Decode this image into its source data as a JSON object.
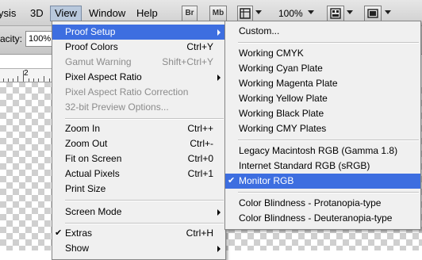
{
  "menubar": {
    "items": [
      "ysis",
      "3D",
      "View",
      "Window",
      "Help"
    ],
    "br_label": "Br",
    "mb_label": "Mb",
    "zoom": "100%"
  },
  "options": {
    "opacity_label": "acity:",
    "opacity_value": "100%"
  },
  "ruler": {
    "label": "2"
  },
  "view_menu": {
    "items": [
      {
        "label": "Proof Setup",
        "shortcut": "",
        "submenu": true,
        "highlighted": true,
        "disabled": false
      },
      {
        "label": "Proof Colors",
        "shortcut": "Ctrl+Y",
        "submenu": false,
        "disabled": false
      },
      {
        "label": "Gamut Warning",
        "shortcut": "Shift+Ctrl+Y",
        "submenu": false,
        "disabled": true
      },
      {
        "label": "Pixel Aspect Ratio",
        "shortcut": "",
        "submenu": true,
        "disabled": false
      },
      {
        "label": "Pixel Aspect Ratio Correction",
        "shortcut": "",
        "submenu": false,
        "disabled": true
      },
      {
        "label": "32-bit Preview Options...",
        "shortcut": "",
        "submenu": false,
        "disabled": true
      },
      {
        "label": "Zoom In",
        "shortcut": "Ctrl++",
        "submenu": false,
        "disabled": false
      },
      {
        "label": "Zoom Out",
        "shortcut": "Ctrl+-",
        "submenu": false,
        "disabled": false
      },
      {
        "label": "Fit on Screen",
        "shortcut": "Ctrl+0",
        "submenu": false,
        "disabled": false
      },
      {
        "label": "Actual Pixels",
        "shortcut": "Ctrl+1",
        "submenu": false,
        "disabled": false
      },
      {
        "label": "Print Size",
        "shortcut": "",
        "submenu": false,
        "disabled": false
      },
      {
        "label": "Screen Mode",
        "shortcut": "",
        "submenu": true,
        "disabled": false
      },
      {
        "label": "Extras",
        "shortcut": "Ctrl+H",
        "submenu": false,
        "disabled": false,
        "checked": true
      },
      {
        "label": "Show",
        "shortcut": "",
        "submenu": true,
        "disabled": false
      }
    ]
  },
  "proof_menu": {
    "items": [
      {
        "label": "Custom..."
      },
      {
        "label": "Working CMYK"
      },
      {
        "label": "Working Cyan Plate"
      },
      {
        "label": "Working Magenta Plate"
      },
      {
        "label": "Working Yellow Plate"
      },
      {
        "label": "Working Black Plate"
      },
      {
        "label": "Working CMY Plates"
      },
      {
        "label": "Legacy Macintosh RGB (Gamma 1.8)"
      },
      {
        "label": "Internet Standard RGB (sRGB)"
      },
      {
        "label": "Monitor RGB",
        "checked": true,
        "highlighted": true
      },
      {
        "label": "Color Blindness - Protanopia-type"
      },
      {
        "label": "Color Blindness - Deuteranopia-type"
      }
    ]
  },
  "colors": {
    "highlight": "#3d6ee0",
    "menu_bg": "#f0f0f0",
    "disabled_text": "#8c8c8c"
  }
}
